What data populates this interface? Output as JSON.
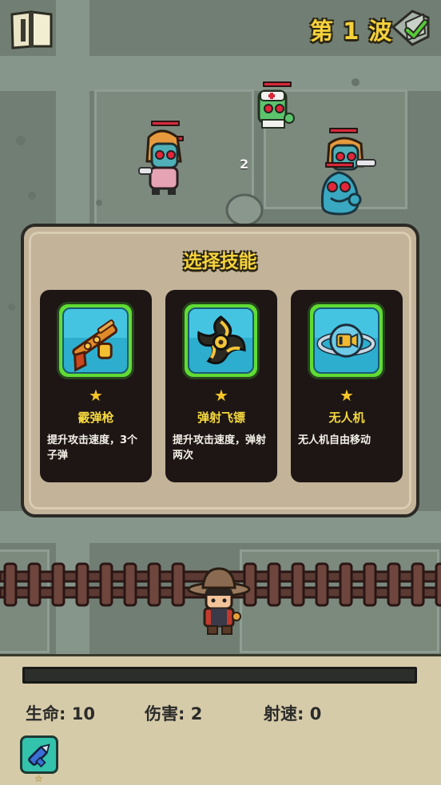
{
  "hud": {
    "wave_label": "第 1 波",
    "book_icon": "book-icon",
    "wave_icon": "wave-check-icon"
  },
  "battle": {
    "damage_popup": "2",
    "enemy_types": [
      "nurse-zombie",
      "zombie-girl",
      "nurse-zombie",
      "blue-blob-zombie",
      "zombie-girl"
    ]
  },
  "skill_dialog": {
    "title": "选择技能",
    "cards": [
      {
        "icon": "shotgun-icon",
        "stars": "★",
        "name": "霰弹枪",
        "desc": "提升攻击速度，3个子弹"
      },
      {
        "icon": "ricochet-shuriken-icon",
        "stars": "★",
        "name": "弹射飞镖",
        "desc": "提升攻击速度，弹射两次"
      },
      {
        "icon": "drone-icon",
        "stars": "★",
        "name": "无人机",
        "desc": "无人机自由移动"
      }
    ]
  },
  "stats": {
    "hp_label": "生命: 10",
    "damage_label": "伤害: 2",
    "fire_rate_label": "射速: 0"
  },
  "experience": {
    "progress": 0
  },
  "owned_skills": [
    {
      "icon": "drill-gun-icon",
      "stars": "☆"
    }
  ],
  "colors": {
    "title_yellow": "#f6d33b",
    "card_bg": "#1d1615",
    "icon_frame_green": "#60dc34",
    "icon_bg_blue": "#2daecf",
    "dialog_bg": "#c2b399",
    "panel_bg": "#d6cba9"
  }
}
